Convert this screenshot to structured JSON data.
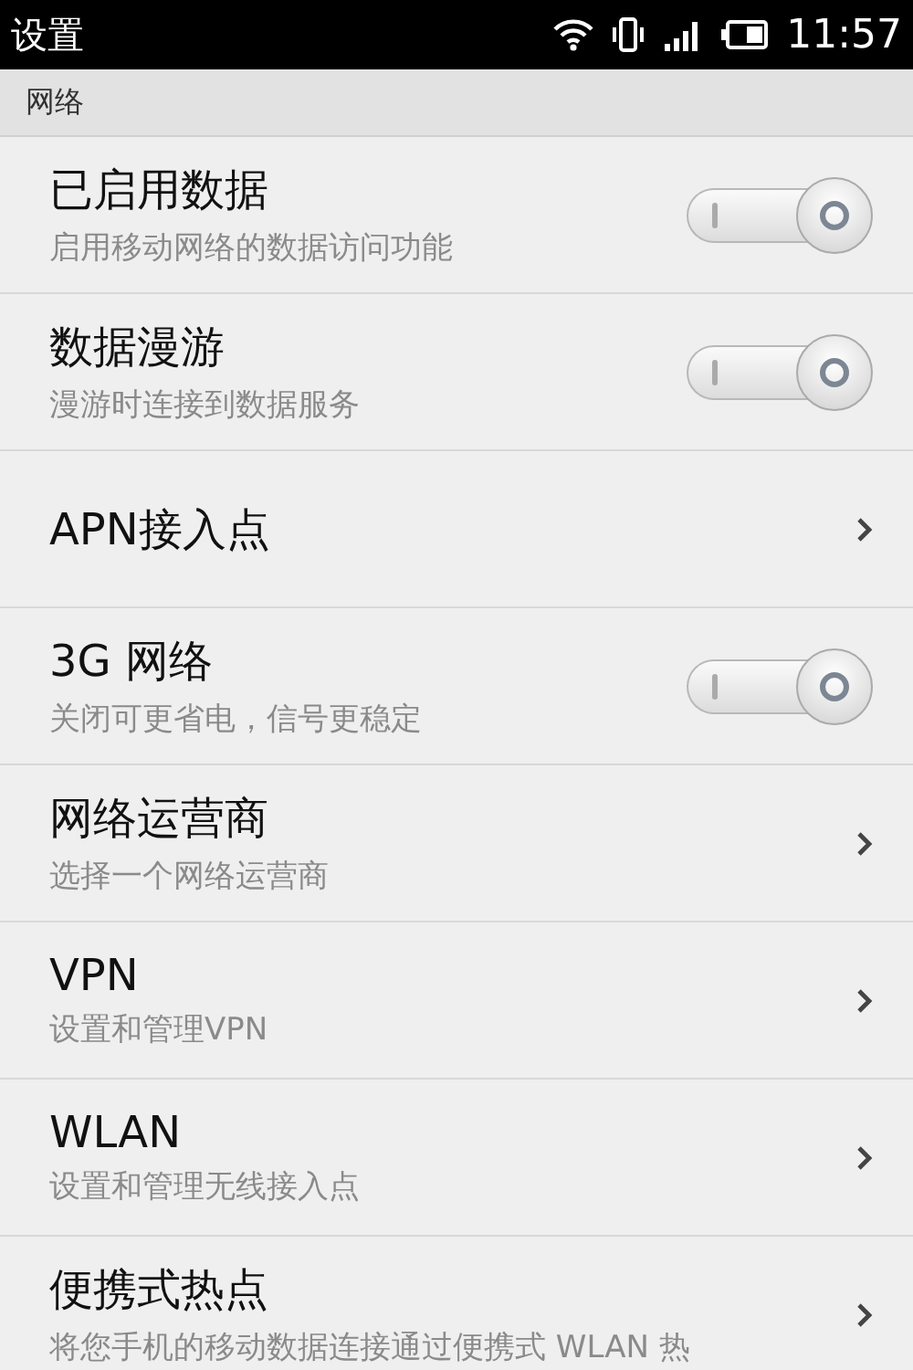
{
  "status_bar": {
    "title": "设置",
    "time": "11:57"
  },
  "section": "网络",
  "rows": [
    {
      "kind": "switch",
      "title": "已启用数据",
      "subtitle": "启用移动网络的数据访问功能",
      "on": true
    },
    {
      "kind": "switch",
      "title": "数据漫游",
      "subtitle": "漫游时连接到数据服务",
      "on": true
    },
    {
      "kind": "link",
      "title": "APN接入点"
    },
    {
      "kind": "switch",
      "title": "3G 网络",
      "subtitle": "关闭可更省电，信号更稳定",
      "on": true
    },
    {
      "kind": "link",
      "title": "网络运营商",
      "subtitle": "选择一个网络运营商"
    },
    {
      "kind": "link",
      "title": "VPN",
      "subtitle": "设置和管理VPN"
    },
    {
      "kind": "link",
      "title": "WLAN",
      "subtitle": "设置和管理无线接入点"
    },
    {
      "kind": "link",
      "title": "便携式热点",
      "subtitle": "将您手机的移动数据连接通过便携式 WLAN 热"
    }
  ]
}
